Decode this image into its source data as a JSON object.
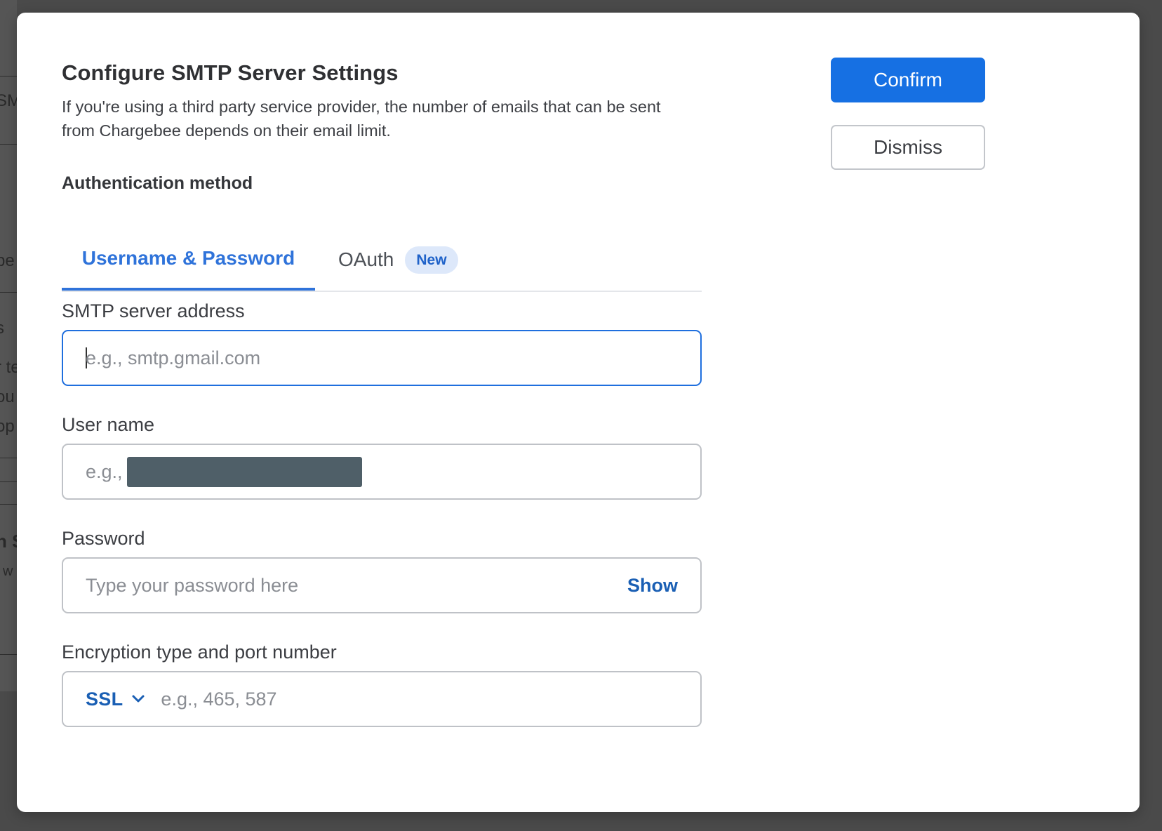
{
  "background": {
    "fragments": [
      "SM",
      "pe",
      "s",
      "r te",
      "ou",
      "op",
      "n S",
      "w"
    ]
  },
  "modal": {
    "title": "Configure SMTP Server Settings",
    "description": "If you're using a third party service provider, the number of emails that can be sent from Chargebee depends on their email limit.",
    "auth_method_label": "Authentication method",
    "tabs": [
      {
        "label": "Username & Password",
        "active": true
      },
      {
        "label": "OAuth",
        "badge": "New",
        "active": false
      }
    ],
    "fields": {
      "smtp_server": {
        "label": "SMTP server address",
        "placeholder": "e.g., smtp.gmail.com",
        "value": ""
      },
      "username": {
        "label": "User name",
        "placeholder_prefix": "e.g.,",
        "value": ""
      },
      "password": {
        "label": "Password",
        "placeholder": "Type your password here",
        "toggle_label": "Show",
        "value": ""
      },
      "encryption": {
        "label": "Encryption type and port number",
        "selected": "SSL",
        "port_placeholder": "e.g., 465, 587",
        "value": ""
      }
    },
    "actions": {
      "confirm_label": "Confirm",
      "dismiss_label": "Dismiss"
    }
  },
  "colors": {
    "accent": "#1670e3",
    "tab_active": "#2f73da",
    "link": "#1a5fb4",
    "badge_bg": "#dde8fa",
    "overlay": "#4a4a4a"
  },
  "icons": {
    "select_chevron": "chevron-down-icon"
  }
}
